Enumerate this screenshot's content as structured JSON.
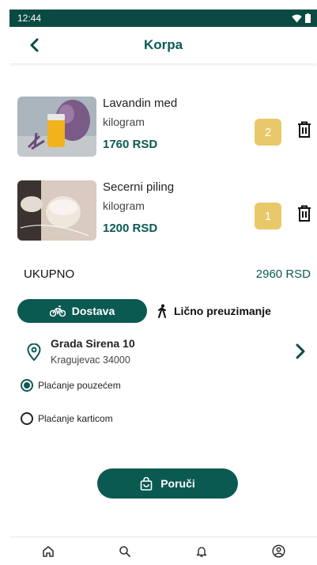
{
  "status_bar": {
    "time": "12:44"
  },
  "header": {
    "title": "Korpa"
  },
  "cart": {
    "items": [
      {
        "name": "Lavandin med",
        "unit": "kilogram",
        "price": "1760 RSD",
        "quantity": "2"
      },
      {
        "name": "Secerni piling",
        "unit": "kilogram",
        "price": "1200 RSD",
        "quantity": "1"
      }
    ],
    "total_label": "UKUPNO",
    "total_value": "2960 RSD"
  },
  "delivery": {
    "options": [
      {
        "label": "Dostava",
        "selected": true
      },
      {
        "label": "Lično preuzimanje",
        "selected": false
      }
    ],
    "address": {
      "street": "Grada Sirena 10",
      "city": "Kragujevac 34000"
    }
  },
  "payment": {
    "options": [
      {
        "label": "Plaćanje pouzećem",
        "selected": true
      },
      {
        "label": "Plaćanje karticom",
        "selected": false
      }
    ]
  },
  "order_button": {
    "label": "Poruči"
  },
  "bottom_nav": [
    "home-icon",
    "search-icon",
    "bell-icon",
    "account-icon"
  ],
  "colors": {
    "primary": "#0b5a52",
    "status_bar": "#0b4a43",
    "quantity_badge": "#e9c86a"
  }
}
